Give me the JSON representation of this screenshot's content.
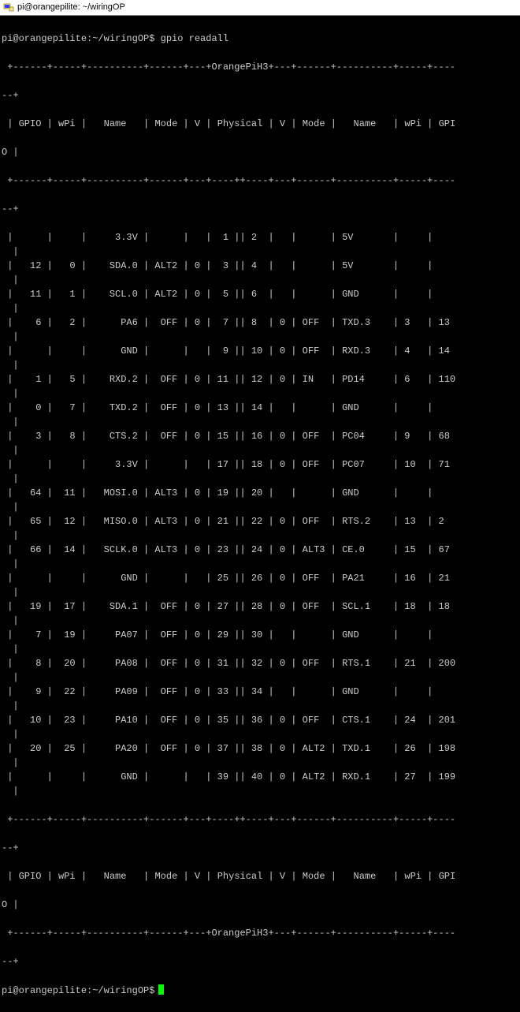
{
  "title": "pi@orangepilite: ~/wiringOP",
  "prompt": "pi@orangepilite:~/wiringOP$ ",
  "command": "gpio readall",
  "board_label": "OrangePiH3",
  "headers": {
    "gpio": "GPIO",
    "wpi": "wPi",
    "name": "Name",
    "mode": "Mode",
    "v": "V",
    "physical": "Physical",
    "v2": "V",
    "mode2": "Mode",
    "name2": "Name",
    "wpi2": "wPi",
    "gpio2": "GPI",
    "gpio2_wrap": "O"
  },
  "rows": [
    {
      "gpio": "",
      "wpi": "",
      "name": "3.3V",
      "mode": "",
      "v": "",
      "p1": "1",
      "p2": "2",
      "v2": "",
      "mode2": "",
      "name2": "5V",
      "wpi2": "",
      "gpio2": ""
    },
    {
      "gpio": "12",
      "wpi": "0",
      "name": "SDA.0",
      "mode": "ALT2",
      "v": "0",
      "p1": "3",
      "p2": "4",
      "v2": "",
      "mode2": "",
      "name2": "5V",
      "wpi2": "",
      "gpio2": ""
    },
    {
      "gpio": "11",
      "wpi": "1",
      "name": "SCL.0",
      "mode": "ALT2",
      "v": "0",
      "p1": "5",
      "p2": "6",
      "v2": "",
      "mode2": "",
      "name2": "GND",
      "wpi2": "",
      "gpio2": ""
    },
    {
      "gpio": "6",
      "wpi": "2",
      "name": "PA6",
      "mode": "OFF",
      "v": "0",
      "p1": "7",
      "p2": "8",
      "v2": "0",
      "mode2": "OFF",
      "name2": "TXD.3",
      "wpi2": "3",
      "gpio2": "13"
    },
    {
      "gpio": "",
      "wpi": "",
      "name": "GND",
      "mode": "",
      "v": "",
      "p1": "9",
      "p2": "10",
      "v2": "0",
      "mode2": "OFF",
      "name2": "RXD.3",
      "wpi2": "4",
      "gpio2": "14"
    },
    {
      "gpio": "1",
      "wpi": "5",
      "name": "RXD.2",
      "mode": "OFF",
      "v": "0",
      "p1": "11",
      "p2": "12",
      "v2": "0",
      "mode2": "IN",
      "name2": "PD14",
      "wpi2": "6",
      "gpio2": "110"
    },
    {
      "gpio": "0",
      "wpi": "7",
      "name": "TXD.2",
      "mode": "OFF",
      "v": "0",
      "p1": "13",
      "p2": "14",
      "v2": "",
      "mode2": "",
      "name2": "GND",
      "wpi2": "",
      "gpio2": ""
    },
    {
      "gpio": "3",
      "wpi": "8",
      "name": "CTS.2",
      "mode": "OFF",
      "v": "0",
      "p1": "15",
      "p2": "16",
      "v2": "0",
      "mode2": "OFF",
      "name2": "PC04",
      "wpi2": "9",
      "gpio2": "68"
    },
    {
      "gpio": "",
      "wpi": "",
      "name": "3.3V",
      "mode": "",
      "v": "",
      "p1": "17",
      "p2": "18",
      "v2": "0",
      "mode2": "OFF",
      "name2": "PC07",
      "wpi2": "10",
      "gpio2": "71"
    },
    {
      "gpio": "64",
      "wpi": "11",
      "name": "MOSI.0",
      "mode": "ALT3",
      "v": "0",
      "p1": "19",
      "p2": "20",
      "v2": "",
      "mode2": "",
      "name2": "GND",
      "wpi2": "",
      "gpio2": ""
    },
    {
      "gpio": "65",
      "wpi": "12",
      "name": "MISO.0",
      "mode": "ALT3",
      "v": "0",
      "p1": "21",
      "p2": "22",
      "v2": "0",
      "mode2": "OFF",
      "name2": "RTS.2",
      "wpi2": "13",
      "gpio2": "2"
    },
    {
      "gpio": "66",
      "wpi": "14",
      "name": "SCLK.0",
      "mode": "ALT3",
      "v": "0",
      "p1": "23",
      "p2": "24",
      "v2": "0",
      "mode2": "ALT3",
      "name2": "CE.0",
      "wpi2": "15",
      "gpio2": "67"
    },
    {
      "gpio": "",
      "wpi": "",
      "name": "GND",
      "mode": "",
      "v": "",
      "p1": "25",
      "p2": "26",
      "v2": "0",
      "mode2": "OFF",
      "name2": "PA21",
      "wpi2": "16",
      "gpio2": "21"
    },
    {
      "gpio": "19",
      "wpi": "17",
      "name": "SDA.1",
      "mode": "OFF",
      "v": "0",
      "p1": "27",
      "p2": "28",
      "v2": "0",
      "mode2": "OFF",
      "name2": "SCL.1",
      "wpi2": "18",
      "gpio2": "18"
    },
    {
      "gpio": "7",
      "wpi": "19",
      "name": "PA07",
      "mode": "OFF",
      "v": "0",
      "p1": "29",
      "p2": "30",
      "v2": "",
      "mode2": "",
      "name2": "GND",
      "wpi2": "",
      "gpio2": ""
    },
    {
      "gpio": "8",
      "wpi": "20",
      "name": "PA08",
      "mode": "OFF",
      "v": "0",
      "p1": "31",
      "p2": "32",
      "v2": "0",
      "mode2": "OFF",
      "name2": "RTS.1",
      "wpi2": "21",
      "gpio2": "200"
    },
    {
      "gpio": "9",
      "wpi": "22",
      "name": "PA09",
      "mode": "OFF",
      "v": "0",
      "p1": "33",
      "p2": "34",
      "v2": "",
      "mode2": "",
      "name2": "GND",
      "wpi2": "",
      "gpio2": ""
    },
    {
      "gpio": "10",
      "wpi": "23",
      "name": "PA10",
      "mode": "OFF",
      "v": "0",
      "p1": "35",
      "p2": "36",
      "v2": "0",
      "mode2": "OFF",
      "name2": "CTS.1",
      "wpi2": "24",
      "gpio2": "201"
    },
    {
      "gpio": "20",
      "wpi": "25",
      "name": "PA20",
      "mode": "OFF",
      "v": "0",
      "p1": "37",
      "p2": "38",
      "v2": "0",
      "mode2": "ALT2",
      "name2": "TXD.1",
      "wpi2": "26",
      "gpio2": "198"
    },
    {
      "gpio": "",
      "wpi": "",
      "name": "GND",
      "mode": "",
      "v": "",
      "p1": "39",
      "p2": "40",
      "v2": "0",
      "mode2": "ALT2",
      "name2": "RXD.1",
      "wpi2": "27",
      "gpio2": "199"
    }
  ],
  "next_prompt": "pi@orangepilite:~/wiringOP$ "
}
